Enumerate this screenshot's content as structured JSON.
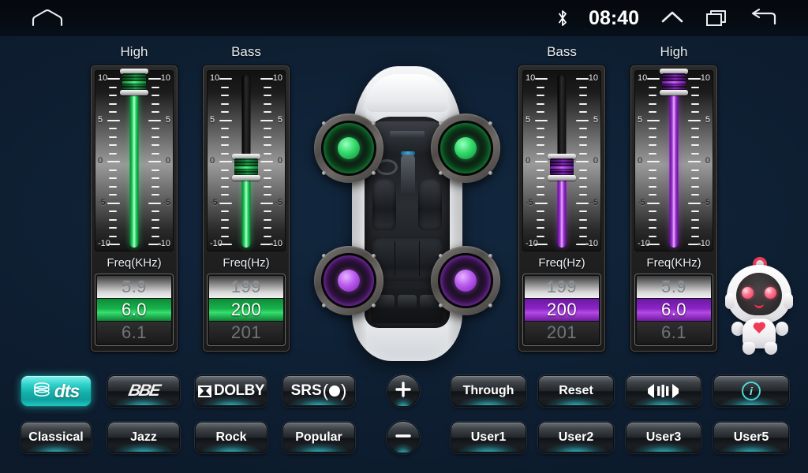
{
  "statusbar": {
    "time": "08:40",
    "icons": [
      "home-icon",
      "bluetooth-icon",
      "chevron-up-icon",
      "recents-icon",
      "back-icon"
    ]
  },
  "channels": [
    {
      "id": "front-high",
      "title": "High",
      "color": "green",
      "accent": "#25d761",
      "gain_value": 10,
      "gain_min": -10,
      "gain_max": 10,
      "freq_label": "Freq(KHz)",
      "freq_prev": "5.9",
      "freq_current": "6.0",
      "freq_next": "6.1",
      "ticks": [
        "10",
        "5",
        "0",
        "-5",
        "-10"
      ]
    },
    {
      "id": "front-bass",
      "title": "Bass",
      "color": "green",
      "accent": "#25d761",
      "gain_value": 0,
      "gain_min": -10,
      "gain_max": 10,
      "freq_label": "Freq(Hz)",
      "freq_prev": "199",
      "freq_current": "200",
      "freq_next": "201",
      "ticks": [
        "10",
        "5",
        "0",
        "-5",
        "-10"
      ]
    },
    {
      "id": "rear-bass",
      "title": "Bass",
      "color": "purple",
      "accent": "#a334d6",
      "gain_value": 0,
      "gain_min": -10,
      "gain_max": 10,
      "freq_label": "Freq(Hz)",
      "freq_prev": "199",
      "freq_current": "200",
      "freq_next": "201",
      "ticks": [
        "10",
        "5",
        "0",
        "-5",
        "-10"
      ]
    },
    {
      "id": "rear-high",
      "title": "High",
      "color": "purple",
      "accent": "#a334d6",
      "gain_value": 10,
      "gain_min": -10,
      "gain_max": 10,
      "freq_label": "Freq(KHz)",
      "freq_prev": "5.9",
      "freq_current": "6.0",
      "freq_next": "6.1",
      "ticks": [
        "10",
        "5",
        "0",
        "-5",
        "-10"
      ]
    }
  ],
  "car": {
    "speakers": [
      {
        "name": "speaker-front-left",
        "color": "green"
      },
      {
        "name": "speaker-front-right",
        "color": "green"
      },
      {
        "name": "speaker-rear-left",
        "color": "purple"
      },
      {
        "name": "speaker-rear-right",
        "color": "purple"
      }
    ]
  },
  "mascot": {
    "name": "robot-mascot"
  },
  "buttons": {
    "row1": [
      {
        "name": "dts-button",
        "label": "dts",
        "type": "logo",
        "active": true
      },
      {
        "name": "bbe-button",
        "label": "BBE",
        "type": "logo",
        "active": false
      },
      {
        "name": "dolby-button",
        "label": "DOLBY",
        "type": "logo",
        "active": false
      },
      {
        "name": "srs-button",
        "label": "SRS",
        "type": "logo",
        "active": false
      },
      {
        "name": "plus-button",
        "label": "+",
        "type": "round",
        "active": false
      },
      {
        "name": "through-button",
        "label": "Through",
        "type": "text",
        "active": false
      },
      {
        "name": "reset-button",
        "label": "Reset",
        "type": "text",
        "active": false
      },
      {
        "name": "balance-button",
        "label": "",
        "type": "icon",
        "active": false
      },
      {
        "name": "info-button",
        "label": "i",
        "type": "icon",
        "active": false
      }
    ],
    "row2": [
      {
        "name": "classical-button",
        "label": "Classical",
        "type": "text",
        "active": false
      },
      {
        "name": "jazz-button",
        "label": "Jazz",
        "type": "text",
        "active": false
      },
      {
        "name": "rock-button",
        "label": "Rock",
        "type": "text",
        "active": false
      },
      {
        "name": "popular-button",
        "label": "Popular",
        "type": "text",
        "active": false
      },
      {
        "name": "minus-button",
        "label": "–",
        "type": "round",
        "active": false
      },
      {
        "name": "user1-button",
        "label": "User1",
        "type": "text",
        "active": false
      },
      {
        "name": "user2-button",
        "label": "User2",
        "type": "text",
        "active": false
      },
      {
        "name": "user3-button",
        "label": "User3",
        "type": "text",
        "active": false
      },
      {
        "name": "user5-button",
        "label": "User5",
        "type": "text",
        "active": false
      }
    ]
  },
  "theme": {
    "background": "#0d1c2e",
    "accent_cyan": "#2fcfc8",
    "green": "#25d761",
    "purple": "#a334d6"
  }
}
